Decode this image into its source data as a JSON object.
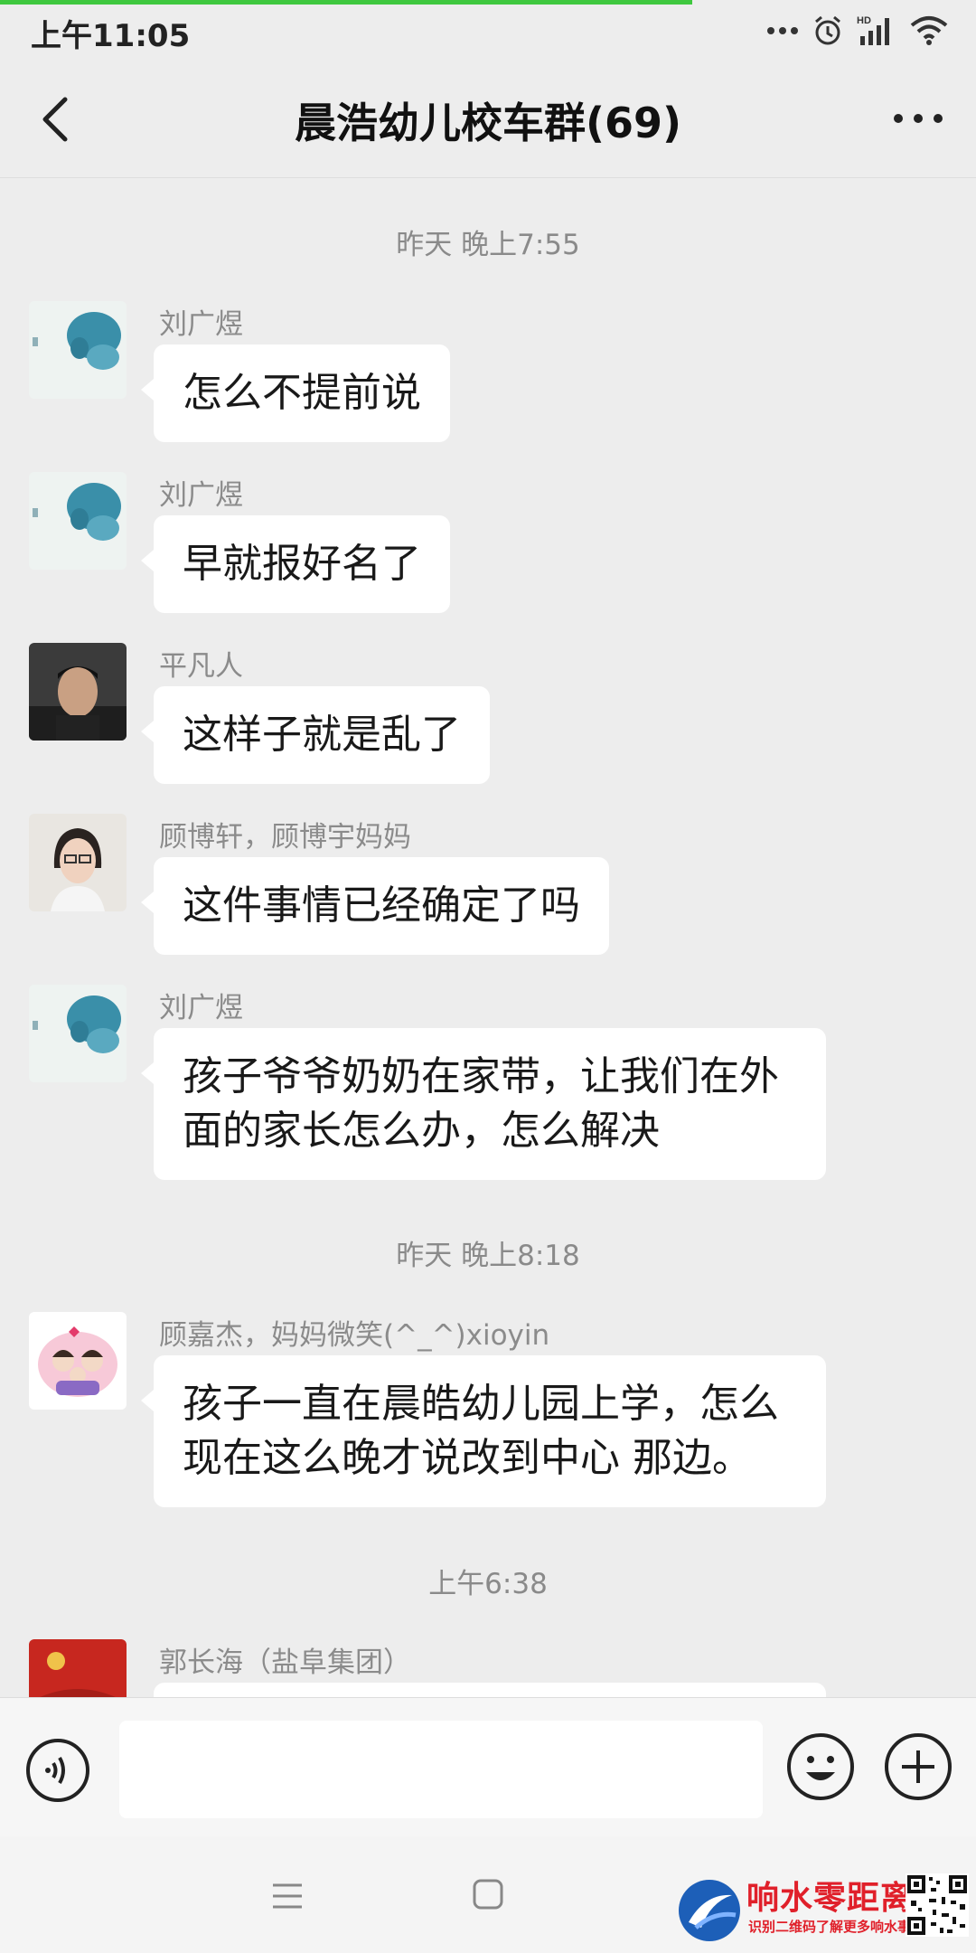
{
  "status_bar": {
    "time": "上午11:05"
  },
  "header": {
    "title": "晨浩幼儿校车群(69)"
  },
  "timestamps": [
    "昨天 晚上7:55",
    "昨天 晚上8:18",
    "上午6:38"
  ],
  "messages": [
    {
      "sender": "刘广煜",
      "text": "怎么不提前说"
    },
    {
      "sender": "刘广煜",
      "text": "早就报好名了"
    },
    {
      "sender": "平凡人",
      "text": "这样子就是乱了"
    },
    {
      "sender": "顾博轩，顾博宇妈妈",
      "text": "这件事情已经确定了吗"
    },
    {
      "sender": "刘广煜",
      "text": "孩子爷爷奶奶在家带，让我们在外面的家长怎么办，怎么解决"
    },
    {
      "sender": "顾嘉杰，妈妈微笑(^_^)xioyin",
      "text": "孩子一直在晨皓幼儿园上学，怎么现在这么晚才说改到中心 那边。"
    },
    {
      "sender": "郭长海（盐阜集团）",
      "text": ""
    }
  ],
  "input": {
    "value": ""
  },
  "watermark": {
    "title": "响水零距离",
    "subtitle": "识别二维码了解更多响水事"
  },
  "colors": {
    "background": "#ededed",
    "bubble": "#ffffff",
    "progress": "#3fc83f",
    "watermark": "#e0202a"
  },
  "icons": [
    "back-arrow-icon",
    "more-icon",
    "voice-icon",
    "emoji-icon",
    "plus-icon",
    "menu-icon",
    "home-icon",
    "alarm-icon",
    "signal-icon",
    "wifi-icon"
  ]
}
